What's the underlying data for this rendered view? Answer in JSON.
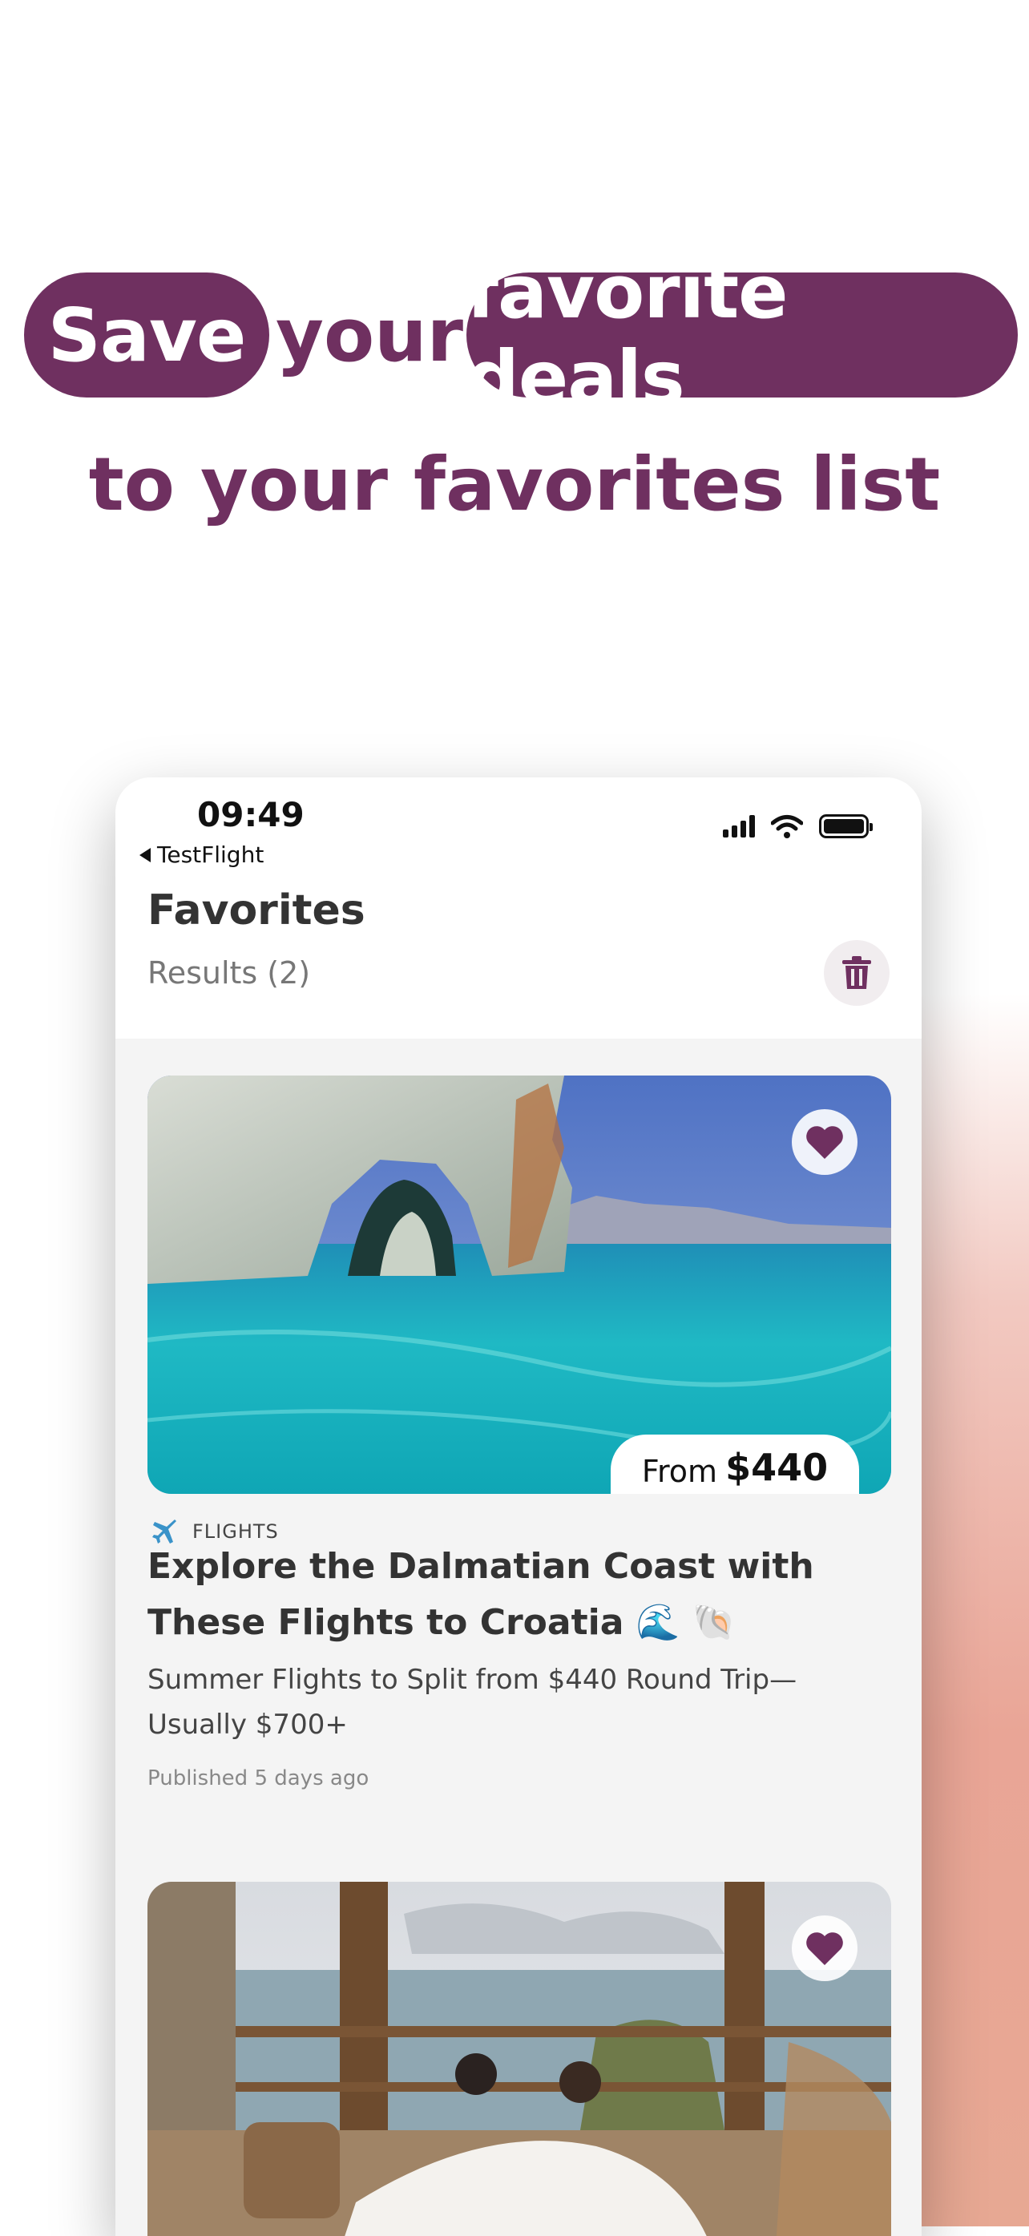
{
  "headline": {
    "pill1": "Save",
    "word": "your",
    "pill2": "favorite deals",
    "line2": "to your favorites list"
  },
  "status_bar": {
    "time": "09:49",
    "back_label": "TestFlight"
  },
  "page": {
    "title": "Favorites",
    "results": "Results (2)"
  },
  "cards": [
    {
      "price_from": "From",
      "price": "$440",
      "category": "FLIGHTS",
      "title": "Explore the Dalmatian Coast with These Flights to Croatia 🌊 🐚",
      "subtitle": "Summer Flights to Split from $440 Round Trip—Usually $700+",
      "meta": "Published 5 days ago",
      "favorited": true
    },
    {
      "favorited": true
    }
  ],
  "colors": {
    "brand": "#6f3060",
    "background": "#ffffff",
    "phone_bg": "#f4f4f4"
  },
  "icons": [
    "trash-icon",
    "heart-icon",
    "airplane-icon",
    "wifi-icon",
    "signal-icon",
    "battery-icon"
  ]
}
